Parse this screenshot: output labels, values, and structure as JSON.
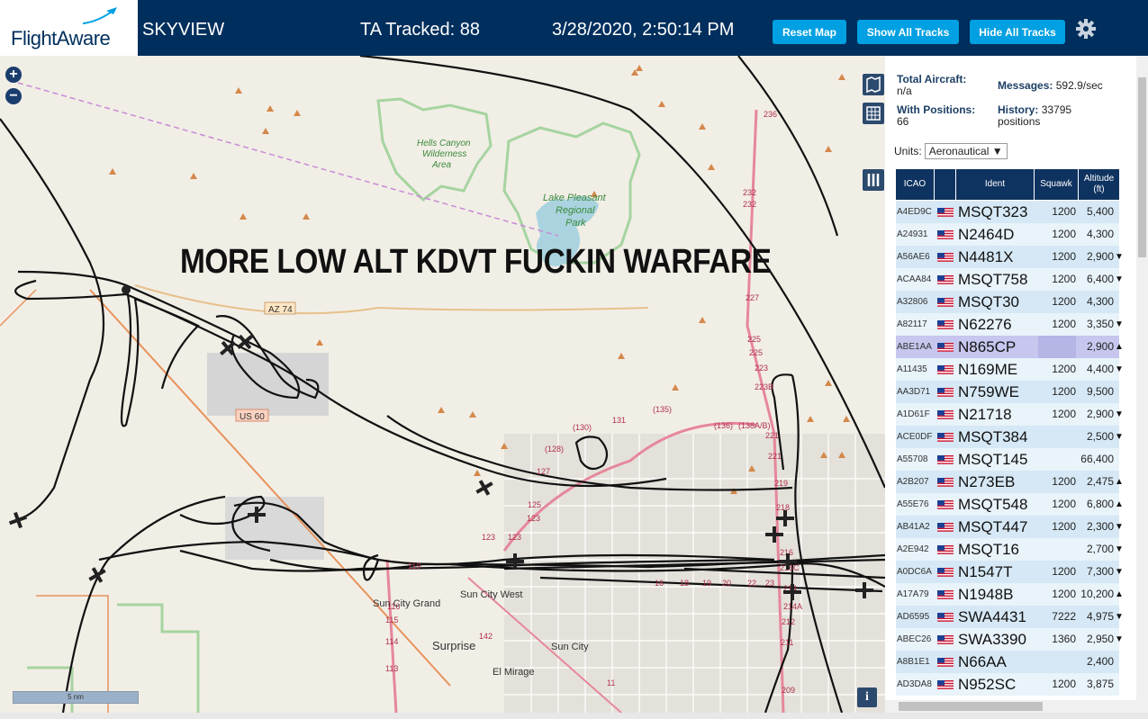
{
  "header": {
    "logo": "FlightAware",
    "app_title": "SKYVIEW",
    "tracked_label": "TA Tracked: 88",
    "datetime": "3/28/2020, 2:50:14 PM",
    "buttons": {
      "reset": "Reset Map",
      "show_all": "Show All Tracks",
      "hide_all": "Hide All Tracks"
    },
    "settings_icon": "gear-icon"
  },
  "map": {
    "caption": "MORE LOW ALT KDVT FUCKIN WARFARE",
    "zoom_in": "+",
    "zoom_out": "−",
    "scale": "5 nm",
    "info": "i",
    "labels": {
      "hells_canyon": "Hells Canyon",
      "wilderness": "Wilderness",
      "area": "Area",
      "lake_pleasant": "Lake Pleasant",
      "regional": "Regional",
      "park": "Park",
      "az74": "AZ 74",
      "us60": "US 60",
      "sun_city_grand": "Sun City Grand",
      "sun_city_west": "Sun City West",
      "sun_city": "Sun City",
      "surprise": "Surprise",
      "el_mirage": "El Mirage"
    },
    "route_numbers": [
      "236",
      "232",
      "232",
      "227",
      "225",
      "225",
      "223",
      "223B",
      "221",
      "221",
      "219",
      "218",
      "216",
      "216C",
      "214",
      "214A",
      "212",
      "211",
      "209",
      "(130)",
      "131",
      "(135)",
      "(136)",
      "(138A/B)",
      "(128)",
      "127",
      "125",
      "123",
      "119",
      "116",
      "115",
      "114",
      "113",
      "142",
      "11",
      "16",
      "18",
      "19",
      "20",
      "22",
      "23"
    ]
  },
  "panel": {
    "total_aircraft_label": "Total Aircraft:",
    "total_aircraft_value": "n/a",
    "messages_label": "Messages:",
    "messages_value": "592.9/sec",
    "with_positions_label": "With Positions:",
    "with_positions_value": "66",
    "history_label": "History:",
    "history_value": "33795",
    "history_unit": "positions",
    "units_label": "Units:",
    "units_value": "Aeronautical ▼",
    "columns": {
      "icao": "ICAO",
      "ident": "Ident",
      "squawk": "Squawk",
      "altitude": "Altitude",
      "altitude_unit": "(ft)"
    },
    "rows": [
      {
        "icao": "A4ED9C",
        "ident": "MSQT323",
        "squawk": "1200",
        "alt": "5,400",
        "arrow": ""
      },
      {
        "icao": "A24931",
        "ident": "N2464D",
        "squawk": "1200",
        "alt": "4,300",
        "arrow": ""
      },
      {
        "icao": "A56AE6",
        "ident": "N4481X",
        "squawk": "1200",
        "alt": "2,900",
        "arrow": "▼"
      },
      {
        "icao": "ACAA84",
        "ident": "MSQT758",
        "squawk": "1200",
        "alt": "6,400",
        "arrow": "▼"
      },
      {
        "icao": "A32806",
        "ident": "MSQT30",
        "squawk": "1200",
        "alt": "4,300",
        "arrow": ""
      },
      {
        "icao": "A82117",
        "ident": "N62276",
        "squawk": "1200",
        "alt": "3,350",
        "arrow": "▼"
      },
      {
        "icao": "ABE1AA",
        "ident": "N865CP",
        "squawk": "",
        "alt": "2,900",
        "arrow": "▲"
      },
      {
        "icao": "A11435",
        "ident": "N169ME",
        "squawk": "1200",
        "alt": "4,400",
        "arrow": "▼"
      },
      {
        "icao": "AA3D71",
        "ident": "N759WE",
        "squawk": "1200",
        "alt": "9,500",
        "arrow": ""
      },
      {
        "icao": "A1D61F",
        "ident": "N21718",
        "squawk": "1200",
        "alt": "2,900",
        "arrow": "▼"
      },
      {
        "icao": "ACE0DF",
        "ident": "MSQT384",
        "squawk": "",
        "alt": "2,500",
        "arrow": "▼"
      },
      {
        "icao": "A55708",
        "ident": "MSQT145",
        "squawk": "",
        "alt": "66,400",
        "arrow": ""
      },
      {
        "icao": "A2B207",
        "ident": "N273EB",
        "squawk": "1200",
        "alt": "2,475",
        "arrow": "▲"
      },
      {
        "icao": "A55E76",
        "ident": "MSQT548",
        "squawk": "1200",
        "alt": "6,800",
        "arrow": "▲"
      },
      {
        "icao": "AB41A2",
        "ident": "MSQT447",
        "squawk": "1200",
        "alt": "2,300",
        "arrow": "▼"
      },
      {
        "icao": "A2E942",
        "ident": "MSQT16",
        "squawk": "",
        "alt": "2,700",
        "arrow": "▼"
      },
      {
        "icao": "A0DC6A",
        "ident": "N1547T",
        "squawk": "1200",
        "alt": "7,300",
        "arrow": "▼"
      },
      {
        "icao": "A17A79",
        "ident": "N1948B",
        "squawk": "1200",
        "alt": "10,200",
        "arrow": "▲"
      },
      {
        "icao": "AD6595",
        "ident": "SWA4431",
        "squawk": "7222",
        "alt": "4,975",
        "arrow": "▼"
      },
      {
        "icao": "ABEC26",
        "ident": "SWA3390",
        "squawk": "1360",
        "alt": "2,950",
        "arrow": "▼"
      },
      {
        "icao": "A8B1E1",
        "ident": "N66AA",
        "squawk": "",
        "alt": "2,400",
        "arrow": ""
      },
      {
        "icao": "AD3DA8",
        "ident": "N952SC",
        "squawk": "1200",
        "alt": "3,875",
        "arrow": ""
      }
    ]
  }
}
